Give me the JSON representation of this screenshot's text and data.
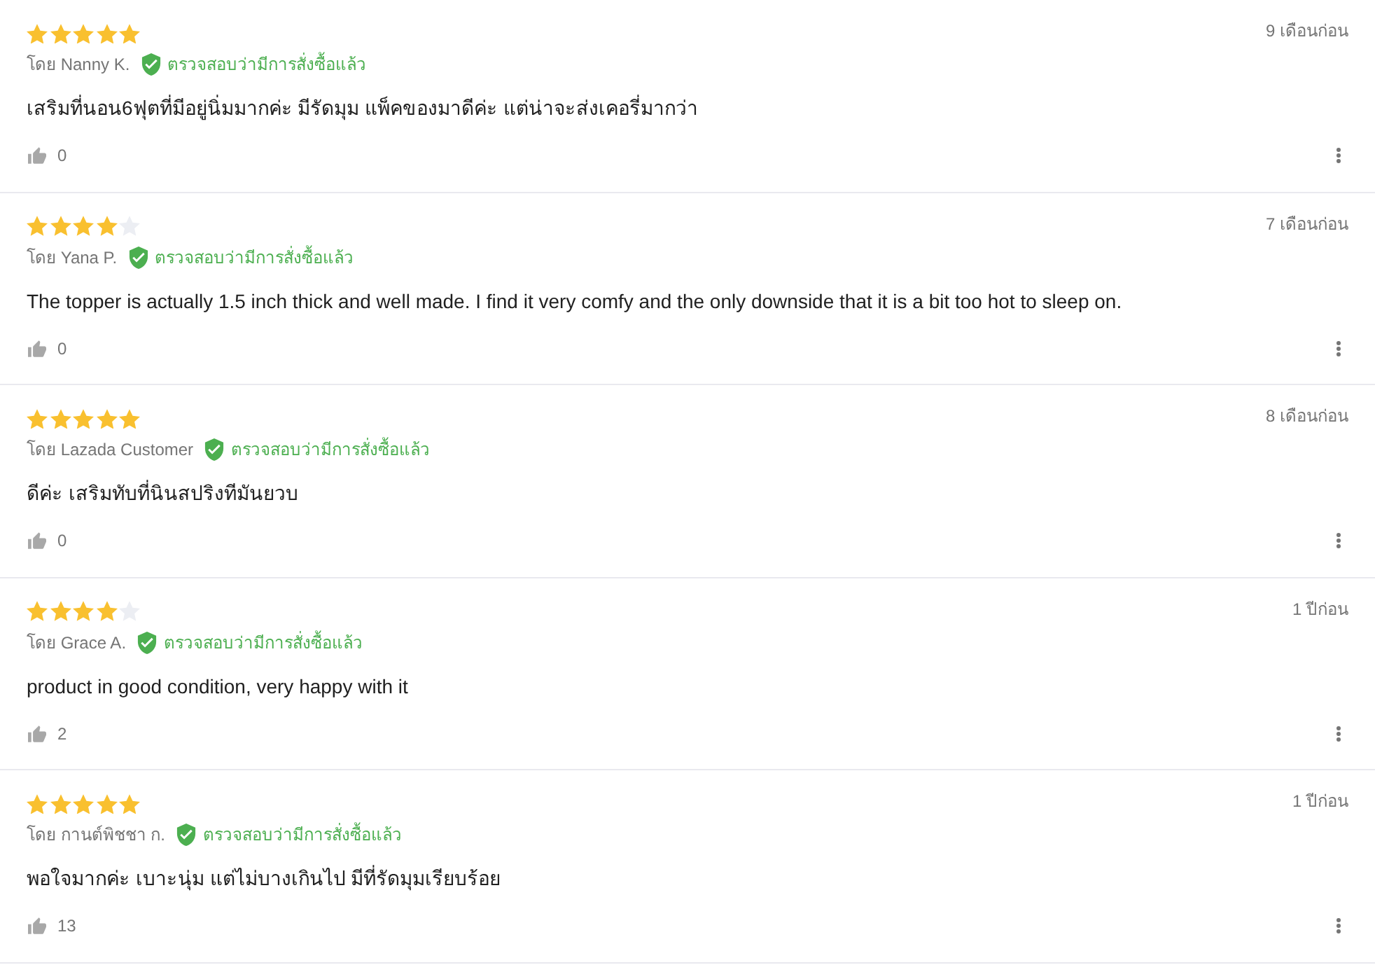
{
  "reviews": [
    {
      "stars": 5,
      "author": "โดย Nanny K.",
      "verified": true,
      "verified_label": "ตรวจสอบว่ามีการสั่งซื้อแล้ว",
      "date": "9 เดือนก่อน",
      "text": "เสริมที่นอน6ฟุตที่มีอยู่นิ่มมากค่ะ มีรัดมุม แพ็คของมาดีค่ะ แต่น่าจะส่งเคอรี่มากว่า",
      "likes": "0"
    },
    {
      "stars": 4,
      "author": "โดย Yana P.",
      "verified": true,
      "verified_label": "ตรวจสอบว่ามีการสั่งซื้อแล้ว",
      "date": "7 เดือนก่อน",
      "text": "The topper is actually 1.5 inch thick and well made. I find it very comfy and the only downside that it is a bit too hot to sleep on.",
      "likes": "0"
    },
    {
      "stars": 5,
      "author": "โดย Lazada Customer",
      "verified": true,
      "verified_label": "ตรวจสอบว่ามีการสั่งซื้อแล้ว",
      "date": "8 เดือนก่อน",
      "text": "ดีค่ะ เสริมทับที่นินสปริงทีมันยวบ",
      "likes": "0"
    },
    {
      "stars": 4,
      "author": "โดย Grace A.",
      "verified": true,
      "verified_label": "ตรวจสอบว่ามีการสั่งซื้อแล้ว",
      "date": "1 ปีก่อน",
      "text": "product in good condition, very happy with it",
      "likes": "2"
    },
    {
      "stars": 5,
      "author": "โดย กานต์พิชชา ก.",
      "verified": true,
      "verified_label": "ตรวจสอบว่ามีการสั่งซื้อแล้ว",
      "date": "1 ปีก่อน",
      "text": "พอใจมากค่ะ เบาะนุ่ม แต่ไม่บางเกินไป มีที่รัดมุมเรียบร้อย",
      "likes": "13"
    }
  ]
}
